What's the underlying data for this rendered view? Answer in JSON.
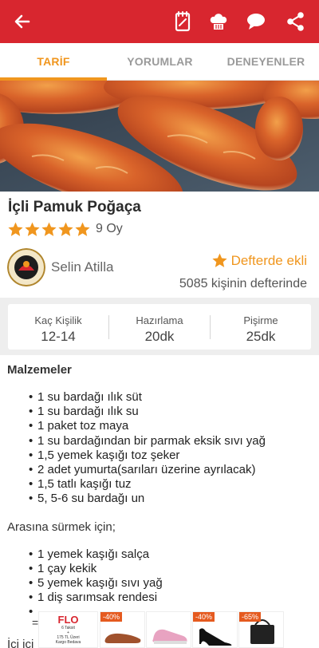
{
  "header": {
    "back_icon": "arrow-left-icon",
    "actions": [
      "notebook-icon",
      "chef-hat-icon",
      "comment-icon",
      "share-icon"
    ],
    "color": "#d8262f"
  },
  "tabs": [
    {
      "label": "TARİF",
      "active": true
    },
    {
      "label": "YORUMLAR",
      "active": false
    },
    {
      "label": "DENEYENLER",
      "active": false
    }
  ],
  "recipe": {
    "title": "İçli Pamuk Poğaça",
    "stars": 5,
    "votes": "9 Oy"
  },
  "author": {
    "name": "Selin Atilla",
    "saved_label": "Defterde ekli",
    "saved_count": "5085 kişinin defterinde"
  },
  "info": [
    {
      "label": "Kaç Kişilik",
      "value": "12-14"
    },
    {
      "label": "Hazırlama",
      "value": "20dk"
    },
    {
      "label": "Pişirme",
      "value": "25dk"
    }
  ],
  "ingredients": {
    "heading": "Malzemeler",
    "items": [
      "1 su bardağı ılık süt",
      "1 su bardağı ılık su",
      "1 paket toz maya",
      "1 su bardağından bir parmak eksik sıvı yağ",
      "1,5 yemek kaşığı toz şeker",
      "2 adet yumurta(sarıları üzerine ayrılacak)",
      "1,5 tatlı kaşığı tuz",
      "5, 5-6 su bardağı un"
    ],
    "spread_heading": "Arasına sürmek için;",
    "spread_items": [
      "1 yemek kaşığı salça",
      "1 çay kekik",
      "5 yemek kaşığı sıvı yağ",
      "1 diş sarımsak rendesi",
      ""
    ],
    "tail": "İçi içi"
  },
  "ad": {
    "brand": "FLO",
    "line1": "6 Taksit",
    "line2": "+",
    "line3": "175 TL Üzeri",
    "line4": "Kargo Bedava",
    "badges": [
      "-40%",
      "-40%",
      "-65%"
    ],
    "eq": "="
  }
}
